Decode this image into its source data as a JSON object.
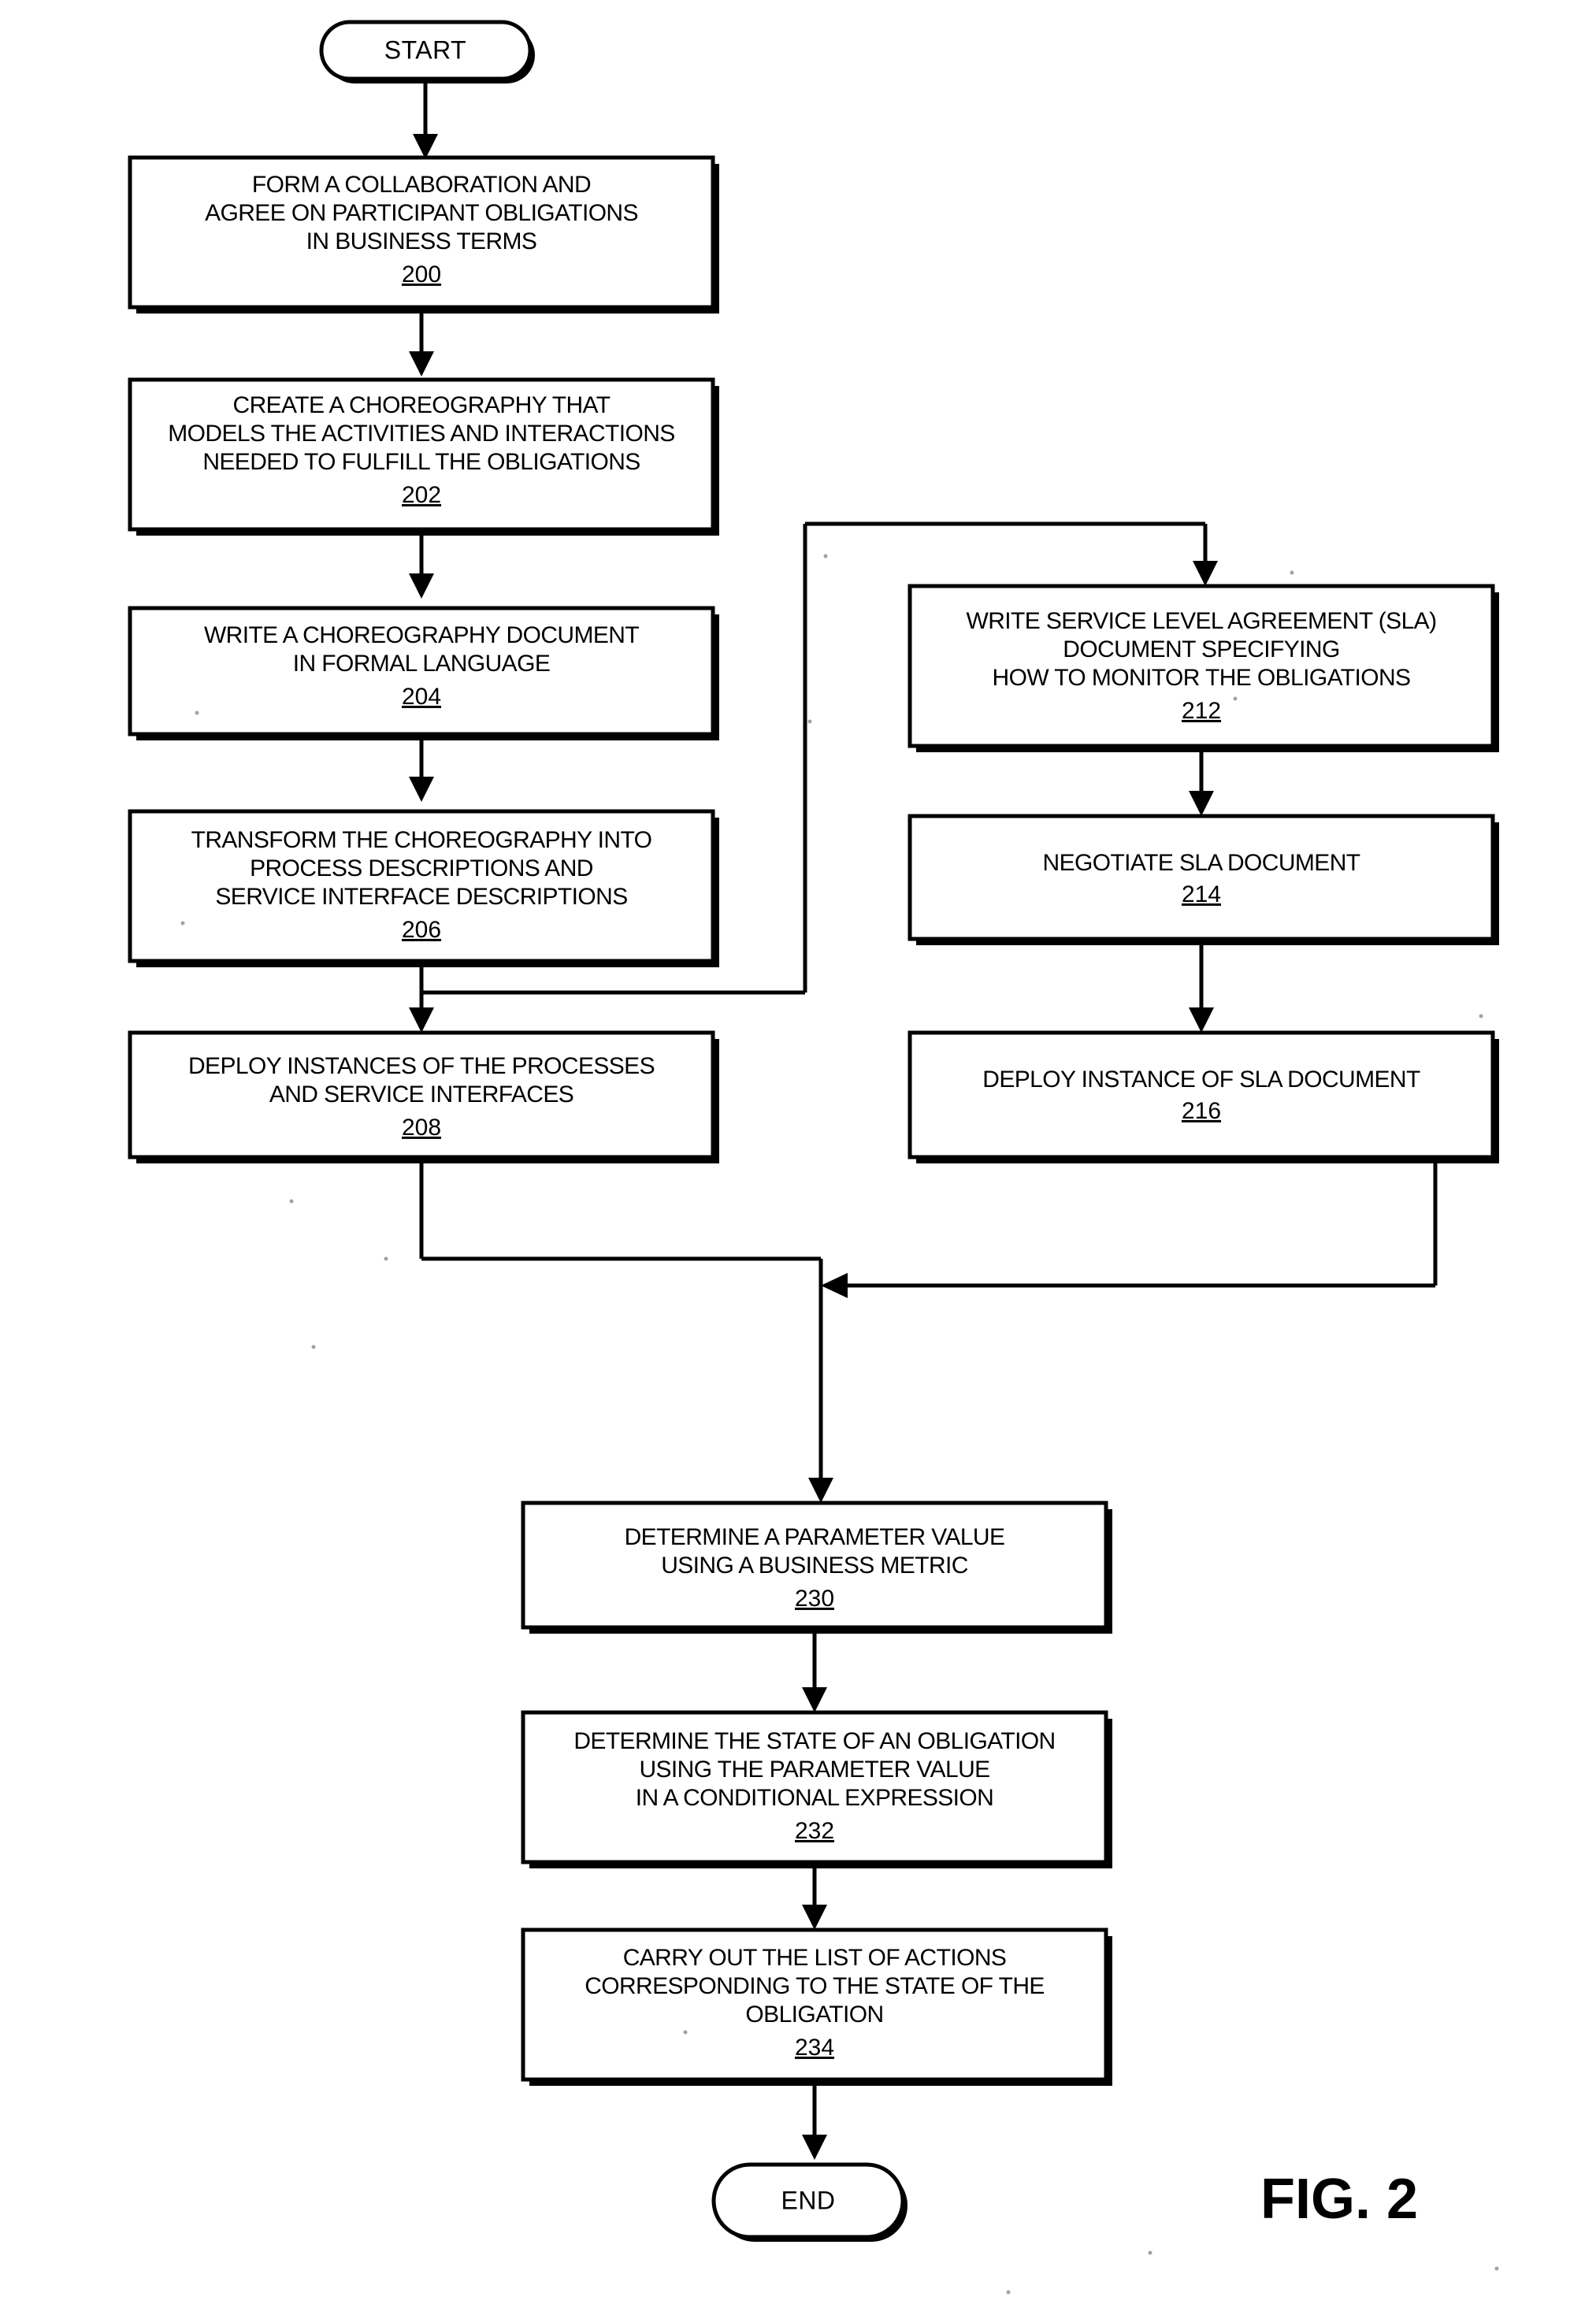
{
  "figure": {
    "label": "FIG. 2",
    "type": "patent-process-flowchart"
  },
  "chart_data": {
    "type": "diagram",
    "title": "FIG. 2",
    "diagram_kind": "flowchart",
    "nodes": [
      {
        "id": "start",
        "shape": "terminator",
        "label": "START",
        "ref": ""
      },
      {
        "id": "n200",
        "shape": "process",
        "ref": "200",
        "lines": [
          "FORM A COLLABORATION AND",
          "AGREE ON PARTICIPANT OBLIGATIONS",
          "IN BUSINESS TERMS"
        ]
      },
      {
        "id": "n202",
        "shape": "process",
        "ref": "202",
        "lines": [
          "CREATE A CHOREOGRAPHY THAT",
          "MODELS THE ACTIVITIES AND INTERACTIONS",
          "NEEDED TO FULFILL THE OBLIGATIONS"
        ]
      },
      {
        "id": "n204",
        "shape": "process",
        "ref": "204",
        "lines": [
          "WRITE A CHOREOGRAPHY DOCUMENT",
          "IN FORMAL LANGUAGE"
        ]
      },
      {
        "id": "n206",
        "shape": "process",
        "ref": "206",
        "lines": [
          "TRANSFORM THE CHOREOGRAPHY INTO",
          "PROCESS DESCRIPTIONS AND",
          "SERVICE INTERFACE DESCRIPTIONS"
        ]
      },
      {
        "id": "n208",
        "shape": "process",
        "ref": "208",
        "lines": [
          "DEPLOY INSTANCES OF THE PROCESSES",
          "AND SERVICE INTERFACES"
        ]
      },
      {
        "id": "n212",
        "shape": "process",
        "ref": "212",
        "lines": [
          "WRITE SERVICE LEVEL AGREEMENT (SLA)",
          "DOCUMENT SPECIFYING",
          "HOW TO MONITOR THE OBLIGATIONS"
        ]
      },
      {
        "id": "n214",
        "shape": "process",
        "ref": "214",
        "lines": [
          "NEGOTIATE SLA DOCUMENT"
        ]
      },
      {
        "id": "n216",
        "shape": "process",
        "ref": "216",
        "lines": [
          "DEPLOY INSTANCE OF SLA DOCUMENT"
        ]
      },
      {
        "id": "n230",
        "shape": "process",
        "ref": "230",
        "lines": [
          "DETERMINE A PARAMETER VALUE",
          "USING A BUSINESS METRIC"
        ]
      },
      {
        "id": "n232",
        "shape": "process",
        "ref": "232",
        "lines": [
          "DETERMINE THE STATE OF AN OBLIGATION",
          "USING THE PARAMETER VALUE",
          "IN A CONDITIONAL EXPRESSION"
        ]
      },
      {
        "id": "n234",
        "shape": "process",
        "ref": "234",
        "lines": [
          "CARRY OUT THE LIST OF ACTIONS",
          "CORRESPONDING TO THE STATE OF THE",
          "OBLIGATION"
        ]
      },
      {
        "id": "end",
        "shape": "terminator",
        "label": "END",
        "ref": ""
      }
    ],
    "edges": [
      {
        "from": "start",
        "to": "n200"
      },
      {
        "from": "n200",
        "to": "n202"
      },
      {
        "from": "n202",
        "to": "n204"
      },
      {
        "from": "n204",
        "to": "n206"
      },
      {
        "from": "n206",
        "to": "n208"
      },
      {
        "from": "n206",
        "to": "n212",
        "routing": "elbow-right"
      },
      {
        "from": "n212",
        "to": "n214"
      },
      {
        "from": "n214",
        "to": "n216"
      },
      {
        "from": "n208",
        "to": "n230",
        "routing": "elbow-merge"
      },
      {
        "from": "n216",
        "to": "n230",
        "routing": "elbow-merge"
      },
      {
        "from": "n230",
        "to": "n232"
      },
      {
        "from": "n232",
        "to": "n234"
      },
      {
        "from": "n234",
        "to": "end"
      }
    ]
  },
  "text": {
    "start": "START",
    "end": "END",
    "fig": "FIG. 2",
    "n200_l1": "FORM A COLLABORATION AND",
    "n200_l2": "AGREE ON PARTICIPANT OBLIGATIONS",
    "n200_l3": "IN BUSINESS TERMS",
    "n200_ref": "200",
    "n202_l1": "CREATE A CHOREOGRAPHY THAT",
    "n202_l2": "MODELS THE ACTIVITIES AND INTERACTIONS",
    "n202_l3": "NEEDED TO FULFILL THE OBLIGATIONS",
    "n202_ref": "202",
    "n204_l1": "WRITE A CHOREOGRAPHY DOCUMENT",
    "n204_l2": "IN FORMAL LANGUAGE",
    "n204_ref": "204",
    "n206_l1": "TRANSFORM THE CHOREOGRAPHY INTO",
    "n206_l2": "PROCESS DESCRIPTIONS AND",
    "n206_l3": "SERVICE INTERFACE DESCRIPTIONS",
    "n206_ref": "206",
    "n208_l1": "DEPLOY INSTANCES OF THE PROCESSES",
    "n208_l2": "AND SERVICE INTERFACES",
    "n208_ref": "208",
    "n212_l1": "WRITE SERVICE LEVEL AGREEMENT (SLA)",
    "n212_l2": "DOCUMENT SPECIFYING",
    "n212_l3": "HOW TO MONITOR THE OBLIGATIONS",
    "n212_ref": "212",
    "n214_l1": "NEGOTIATE SLA DOCUMENT",
    "n214_ref": "214",
    "n216_l1": "DEPLOY INSTANCE OF SLA DOCUMENT",
    "n216_ref": "216",
    "n230_l1": "DETERMINE A PARAMETER VALUE",
    "n230_l2": "USING A BUSINESS METRIC",
    "n230_ref": "230",
    "n232_l1": "DETERMINE THE STATE OF AN OBLIGATION",
    "n232_l2": "USING THE PARAMETER VALUE",
    "n232_l3": "IN A CONDITIONAL EXPRESSION",
    "n232_ref": "232",
    "n234_l1": "CARRY OUT THE LIST OF ACTIONS",
    "n234_l2": "CORRESPONDING TO THE STATE OF THE",
    "n234_l3": "OBLIGATION",
    "n234_ref": "234"
  },
  "colors": {
    "ink": "#000000",
    "paper": "#ffffff"
  }
}
